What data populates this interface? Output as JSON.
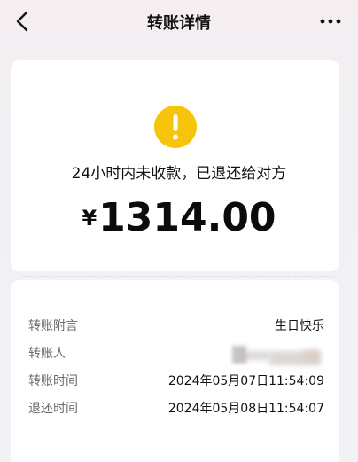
{
  "nav": {
    "title": "转账详情",
    "back_icon": "chevron-left-icon",
    "more_icon": "more-horizontal-icon"
  },
  "status": {
    "icon": "warning-icon",
    "icon_color": "#f6c40c",
    "text": "24小时内未收款，已退还给对方"
  },
  "amount": {
    "currency": "¥",
    "value": "1314.00"
  },
  "details": [
    {
      "label": "转账附言",
      "value": "生日快乐"
    },
    {
      "label": "转账人",
      "value": ""
    },
    {
      "label": "转账时间",
      "value": "2024年05月07日11:54:09"
    },
    {
      "label": "退还时间",
      "value": "2024年05月08日11:54:07"
    }
  ]
}
